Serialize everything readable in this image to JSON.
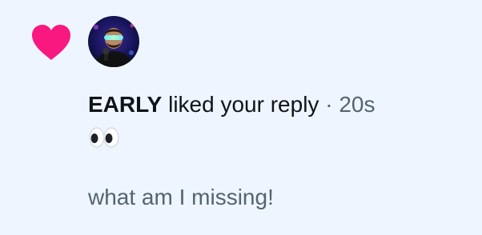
{
  "notification": {
    "type_icon": "heart-icon",
    "avatar_icon": "user-avatar",
    "username": "EARLY",
    "action": " liked your reply",
    "separator": " · ",
    "timestamp": "20s",
    "emoji": "eyes-emoji",
    "reply_text": "what am I missing!"
  },
  "colors": {
    "background": "#eef5fe",
    "heart": "#f91880",
    "text_primary": "#0f1419",
    "text_secondary": "#536471"
  }
}
